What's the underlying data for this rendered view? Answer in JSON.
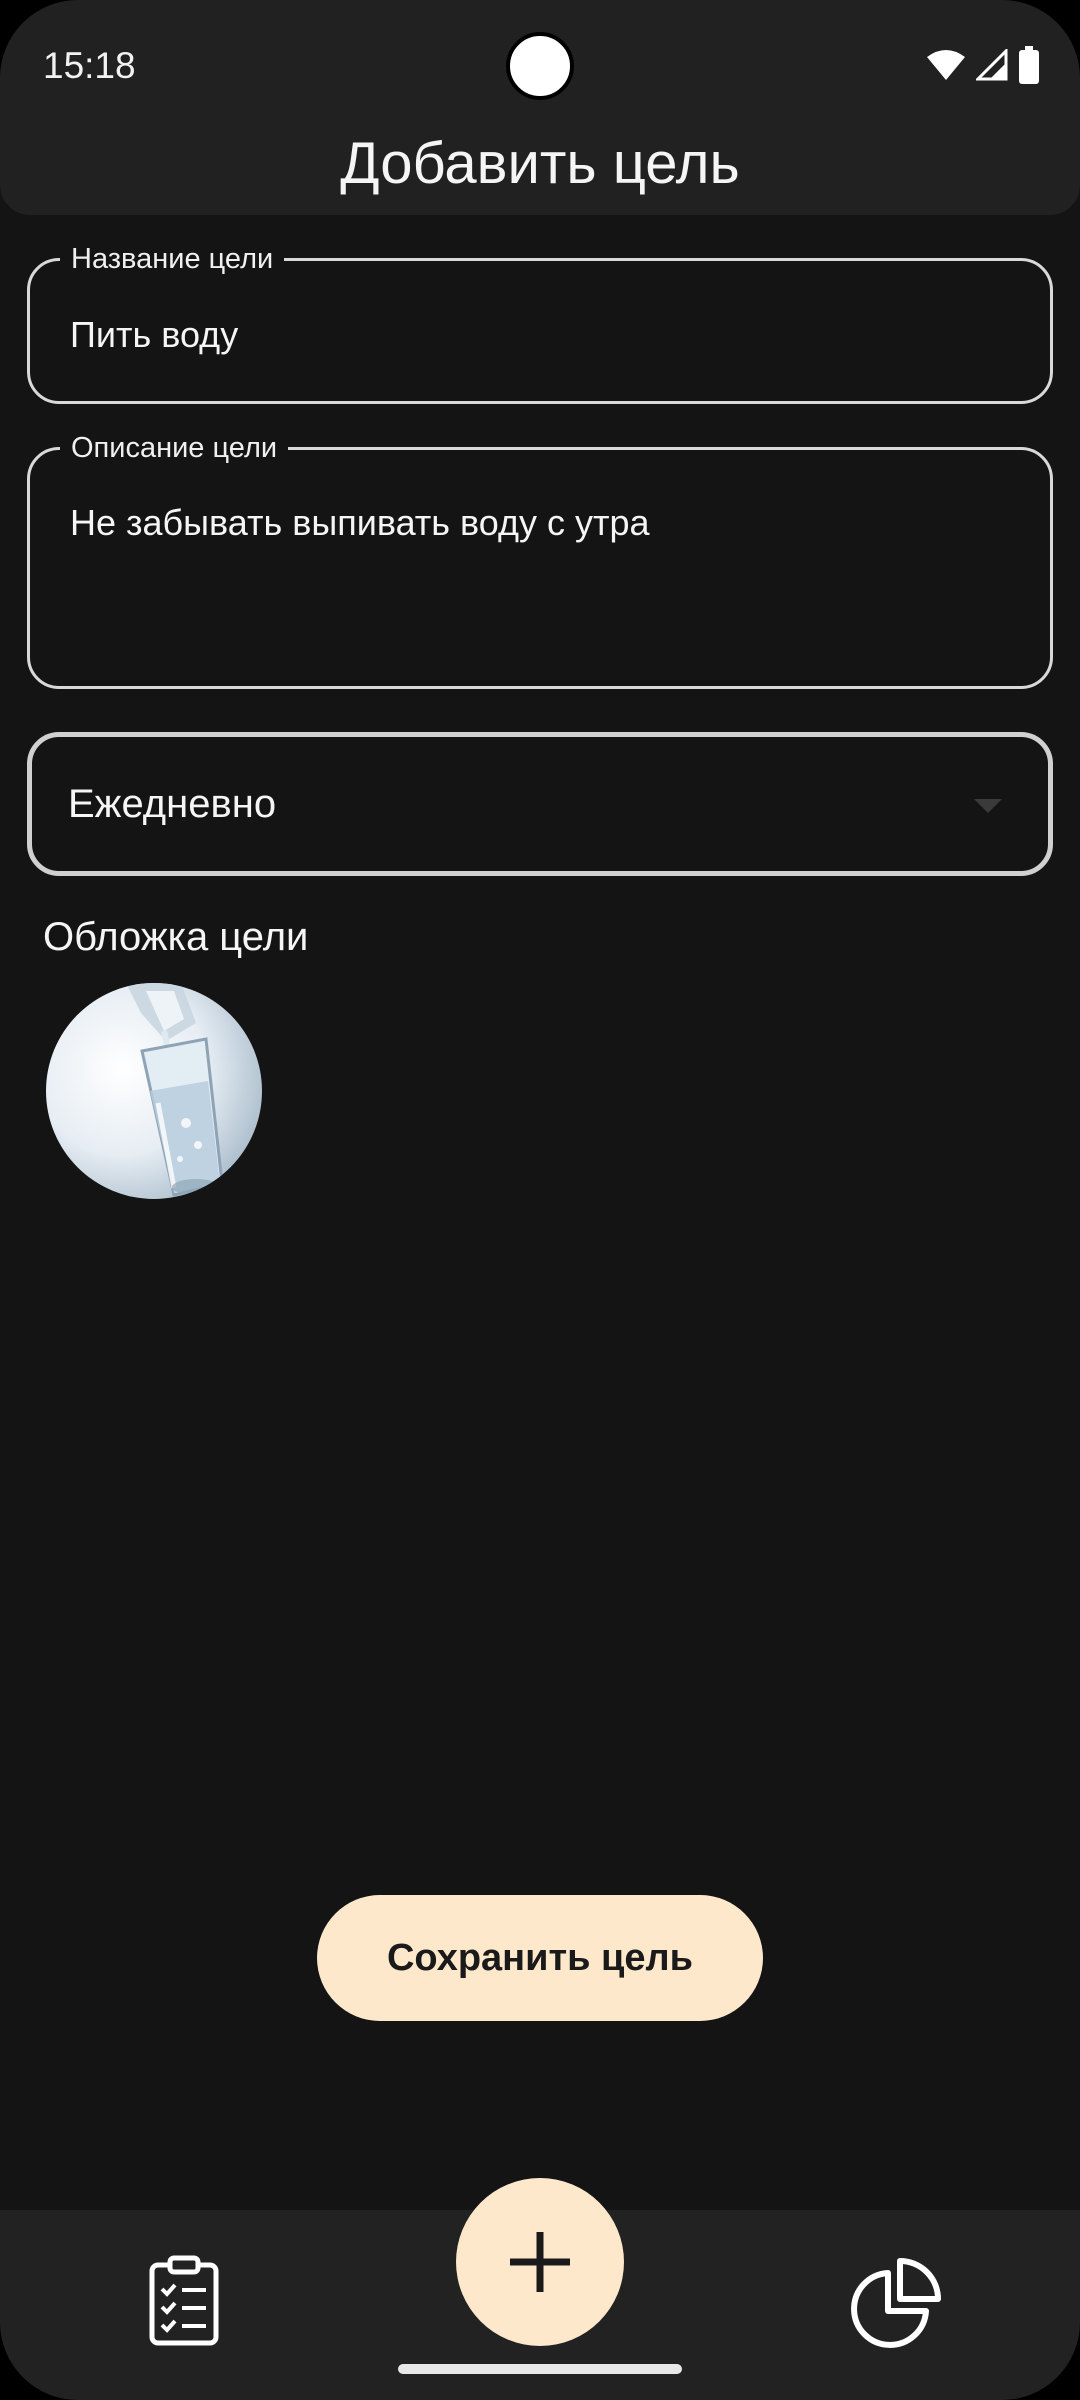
{
  "status_bar": {
    "time": "15:18",
    "icons": [
      "wifi-icon",
      "cellular-signal-icon",
      "battery-icon"
    ]
  },
  "header": {
    "title": "Добавить цель"
  },
  "form": {
    "name_field": {
      "label": "Название цели",
      "value": "Пить воду"
    },
    "description_field": {
      "label": "Описание цели",
      "value": "Не забывать выпивать воду с утра"
    },
    "frequency_select": {
      "value": "Ежедневно"
    },
    "cover": {
      "label": "Обложка цели",
      "image": "glass-of-water-photo"
    },
    "save_button": {
      "label": "Сохранить цель"
    }
  },
  "bottom_nav": {
    "items": [
      {
        "icon": "checklist-icon"
      },
      {
        "icon": "plus-icon"
      },
      {
        "icon": "pie-chart-icon"
      }
    ]
  },
  "colors": {
    "background": "#141414",
    "surface": "#212121",
    "accent": "#fde8cc",
    "outline": "#d9d9d9",
    "text": "#f5f5f5"
  }
}
